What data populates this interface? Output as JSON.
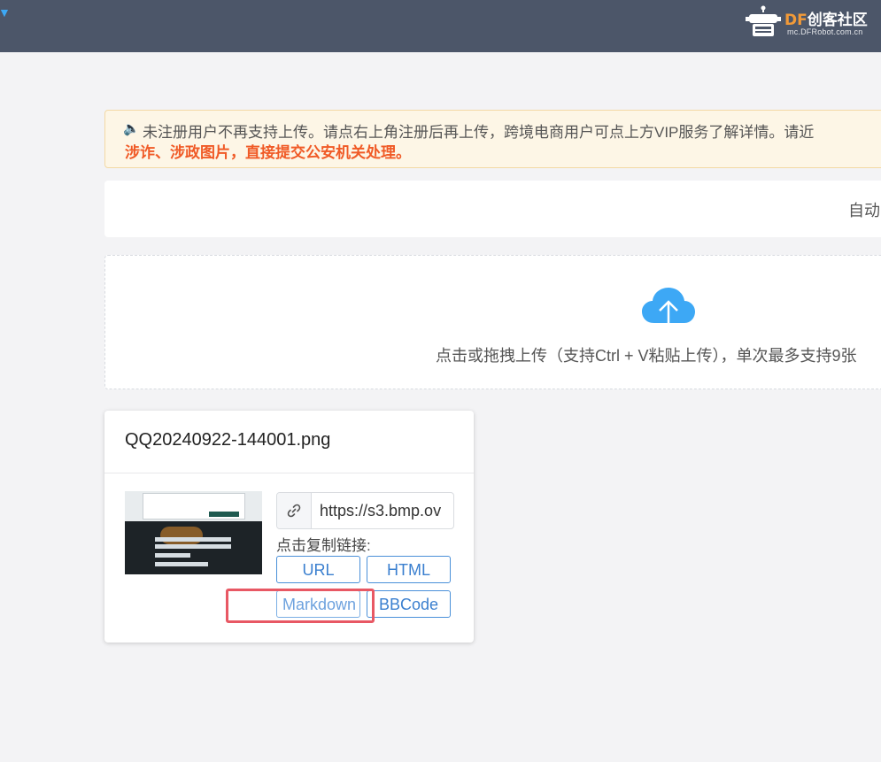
{
  "header": {
    "logo_df": "DF",
    "logo_name": "创客社区",
    "logo_domain": "mc.DFRobot.com.cn"
  },
  "notice": {
    "line1": "未注册用户不再支持上传。请点右上角注册后再上传，跨境电商用户可点上方VIP服务了解详情。请近",
    "line2": "涉诈、涉政图片，直接提交公安机关处理。"
  },
  "auto_panel": {
    "text": "自动"
  },
  "upload": {
    "hint": "点击或拖拽上传（支持Ctrl + V粘贴上传），单次最多支持9张"
  },
  "file_card": {
    "filename": "QQ20240922-144001.png",
    "url_value": "https://s3.bmp.ov",
    "copy_label": "点击复制链接:",
    "buttons": {
      "url": "URL",
      "html": "HTML",
      "markdown": "Markdown",
      "bbcode": "BBCode"
    }
  },
  "colors": {
    "topbar": "#4c5669",
    "accent_blue": "#4a90d9",
    "notice_red": "#f05a26",
    "highlight_red": "#e85864"
  }
}
